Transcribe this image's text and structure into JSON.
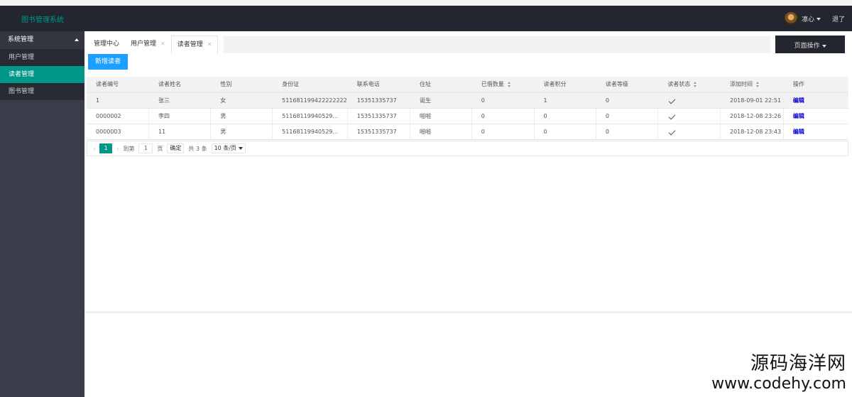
{
  "header": {
    "logo": "图书管理系统",
    "user_name": "凛心",
    "logout": "退了"
  },
  "sidebar": {
    "group_label": "系统管理",
    "items": [
      {
        "label": "用户管理",
        "active": false
      },
      {
        "label": "读者管理",
        "active": true
      },
      {
        "label": "图书管理",
        "active": false
      }
    ]
  },
  "tabs": [
    {
      "label": "管理中心",
      "closable": false,
      "active": false
    },
    {
      "label": "用户管理",
      "closable": true,
      "active": false
    },
    {
      "label": "读者管理",
      "closable": true,
      "active": true
    }
  ],
  "page_ops_label": "页面操作",
  "toolbar": {
    "add_label": "新增读者"
  },
  "table": {
    "columns": [
      {
        "label": "读者编号",
        "sortable": false
      },
      {
        "label": "读者姓名",
        "sortable": false
      },
      {
        "label": "性别",
        "sortable": false
      },
      {
        "label": "身份证",
        "sortable": false
      },
      {
        "label": "联系电话",
        "sortable": false
      },
      {
        "label": "住址",
        "sortable": false
      },
      {
        "label": "已借数量",
        "sortable": true
      },
      {
        "label": "读者积分",
        "sortable": false
      },
      {
        "label": "读者等级",
        "sortable": false
      },
      {
        "label": "读者状态",
        "sortable": true
      },
      {
        "label": "添加时间",
        "sortable": true
      },
      {
        "label": "操作",
        "sortable": false
      }
    ],
    "rows": [
      {
        "id": "1",
        "name": "张三",
        "gender": "女",
        "id_card": "511681199422222222",
        "phone": "15351335737",
        "address": "诞生",
        "borrowed": "0",
        "points": "1",
        "level": "0",
        "status": "enabled",
        "added": "2018-09-01 22:51",
        "action": "编辑"
      },
      {
        "id": "0000002",
        "name": "李四",
        "gender": "男",
        "id_card": "51168119940529...",
        "phone": "15351335737",
        "address": "啪啪",
        "borrowed": "0",
        "points": "0",
        "level": "0",
        "status": "enabled",
        "added": "2018-12-08 23:26",
        "action": "编辑"
      },
      {
        "id": "0000003",
        "name": "11",
        "gender": "男",
        "id_card": "51168119940529...",
        "phone": "15351335737",
        "address": "啪啪",
        "borrowed": "0",
        "points": "0",
        "level": "0",
        "status": "enabled",
        "added": "2018-12-08 23:43",
        "action": "编辑"
      }
    ]
  },
  "pager": {
    "prev": "‹",
    "current": "1",
    "next": "›",
    "goto_label": "到第",
    "goto_value": "1",
    "page_unit": "页",
    "confirm": "确定",
    "total": "共 3 条",
    "page_size": "10 条/页"
  },
  "watermark": {
    "line1": "源码海洋网",
    "line2": "www.codehy.com"
  }
}
